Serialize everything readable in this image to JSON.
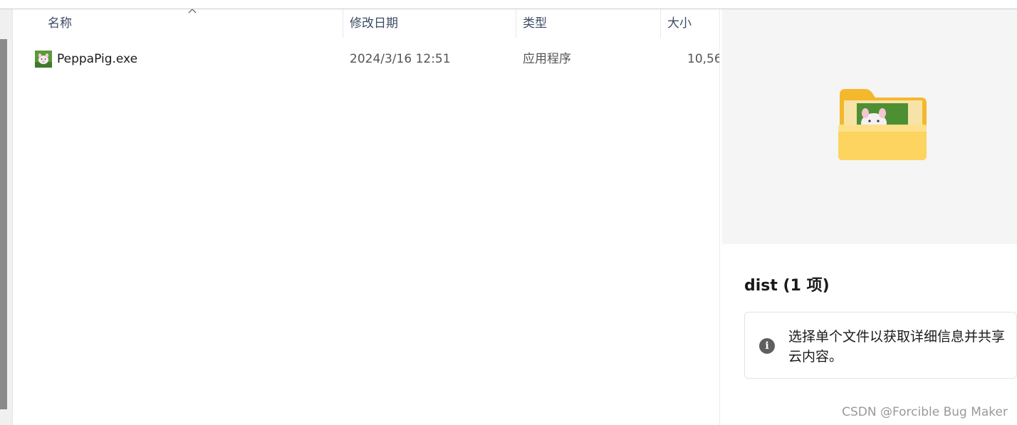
{
  "columns": {
    "name": "名称",
    "modified": "修改日期",
    "type": "类型",
    "size": "大小"
  },
  "files": [
    {
      "name": "PeppaPig.exe",
      "modified": "2024/3/16 12:51",
      "type": "应用程序",
      "size": "10,56"
    }
  ],
  "preview": {
    "title": "dist (1 项)",
    "info_text": "选择单个文件以获取详细信息并共享云内容。",
    "info_icon": "info-icon"
  },
  "watermark": "CSDN @Forcible Bug Maker",
  "colors": {
    "header_text": "#3b4a63",
    "folder_yellow": "#f7c948",
    "info_icon_bg": "#5f5f5f"
  }
}
